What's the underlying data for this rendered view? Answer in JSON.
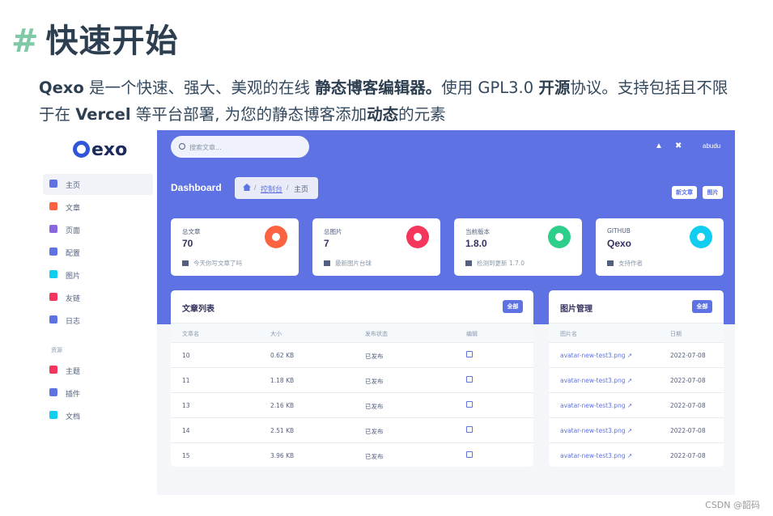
{
  "doc": {
    "hash": "#",
    "title": "快速开始",
    "para": {
      "p1": "Qexo",
      "p2": " 是一个快速、强大、美观的在线 ",
      "p3": "静态博客编辑器。",
      "p4": "使用 GPL3.0 ",
      "p5": "开源",
      "p6": "协议。支持包括且不限于在 ",
      "p7": "Vercel",
      "p8": " 等平台部署, 为您的静态博客添加",
      "p9": "动态",
      "p10": "的元素"
    }
  },
  "app": {
    "logo": "exo",
    "sidebar": {
      "items": [
        {
          "label": "主页",
          "icon": "monitor-icon",
          "color": "#5e72e4"
        },
        {
          "label": "文章",
          "icon": "document-icon",
          "color": "#fb6340"
        },
        {
          "label": "页面",
          "icon": "cube-icon",
          "color": "#8965e0"
        },
        {
          "label": "配置",
          "icon": "gear-icon",
          "color": "#5e72e4"
        },
        {
          "label": "图片",
          "icon": "image-icon",
          "color": "#11cdef"
        },
        {
          "label": "友链",
          "icon": "gift-icon",
          "color": "#f5365c"
        },
        {
          "label": "日志",
          "icon": "lock-icon",
          "color": "#5e72e4"
        }
      ],
      "section_title": "资源",
      "resources": [
        {
          "label": "主题",
          "icon": "palette-icon",
          "color": "#f5365c"
        },
        {
          "label": "插件",
          "icon": "tools-icon",
          "color": "#5e72e4"
        },
        {
          "label": "文档",
          "icon": "send-icon",
          "color": "#11cdef"
        }
      ]
    },
    "topbar": {
      "search_placeholder": "搜索文章...",
      "bell_icon": "bell-icon",
      "tools_icon": "tools-icon",
      "user": "abudu"
    },
    "header": {
      "title": "Dashboard",
      "breadcrumb": {
        "sep": "/",
        "parent": "控制台",
        "current": "主页"
      },
      "buttons": {
        "new_post": "新文章",
        "images": "图片"
      }
    },
    "stats": [
      {
        "title": "总文章",
        "value": "70",
        "footer": "今天你写文章了吗",
        "color": "#fb6340",
        "icon": "pie-chart-icon"
      },
      {
        "title": "总图片",
        "value": "7",
        "footer": "最新图片台球",
        "color": "#f5365c",
        "icon": "hand-icon"
      },
      {
        "title": "当前版本",
        "value": "1.8.0",
        "footer": "检测到更新 1.7.0",
        "color": "#2dce89",
        "icon": "copy-icon"
      },
      {
        "title": "GITHUB",
        "value": "Qexo",
        "footer": "支持作者",
        "color": "#11cdef",
        "icon": "bar-chart-icon"
      }
    ],
    "posts": {
      "title": "文章列表",
      "all": "全部",
      "columns": [
        "文章名",
        "大小",
        "发布状态",
        "编辑"
      ],
      "rows": [
        {
          "name": "10",
          "size": "0.62 KB",
          "status": "已发布"
        },
        {
          "name": "11",
          "size": "1.18 KB",
          "status": "已发布"
        },
        {
          "name": "13",
          "size": "2.16 KB",
          "status": "已发布"
        },
        {
          "name": "14",
          "size": "2.51 KB",
          "status": "已发布"
        },
        {
          "name": "15",
          "size": "3.96 KB",
          "status": "已发布"
        }
      ]
    },
    "images": {
      "title": "图片管理",
      "all": "全部",
      "columns": [
        "图片名",
        "日期"
      ],
      "rows": [
        {
          "name": "avatar-new-test3.png",
          "date": "2022-07-08"
        },
        {
          "name": "avatar-new-test3.png",
          "date": "2022-07-08"
        },
        {
          "name": "avatar-new-test3.png",
          "date": "2022-07-08"
        },
        {
          "name": "avatar-new-test3.png",
          "date": "2022-07-08"
        },
        {
          "name": "avatar-new-test3.png",
          "date": "2022-07-08"
        }
      ]
    }
  },
  "credit": "CSDN @韶码"
}
